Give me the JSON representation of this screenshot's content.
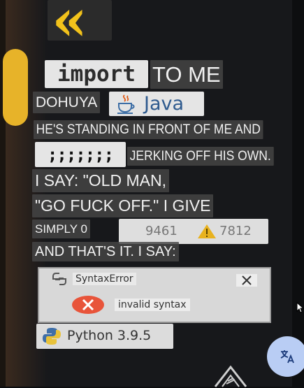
{
  "meme": {
    "line1_code": "import",
    "line1_text": "TO ME",
    "line2_text": "DOHUYA",
    "line2_java": "Java",
    "line3_text": "HE'S STANDING IN FRONT OF ME AND",
    "line4_text": "JERKING OFF HIS OWN.",
    "line5_text": "I SAY: \"OLD MAN,",
    "line6_text": "\"GO FUCK OFF.\" I GIVE",
    "line7_text": "SIMPLY 0",
    "counter_a": "9461",
    "counter_b": "7812",
    "line8_text": "AND THAT'S IT. I SAY:",
    "error_title": "SyntaxError",
    "error_message": "invalid syntax",
    "python_label": "Python 3.9.5"
  },
  "colors": {
    "quote_yellow": "#f2c21b",
    "error_red": "#e8543a",
    "translate_blue": "#b9cdf4"
  },
  "icons": {
    "quote": "left-double-angle-quote-icon",
    "java": "java-coffee-cup-icon",
    "warning": "warning-triangle-icon",
    "error": "error-x-circle-icon",
    "python": "python-logo-icon",
    "translate": "translate-icon"
  }
}
